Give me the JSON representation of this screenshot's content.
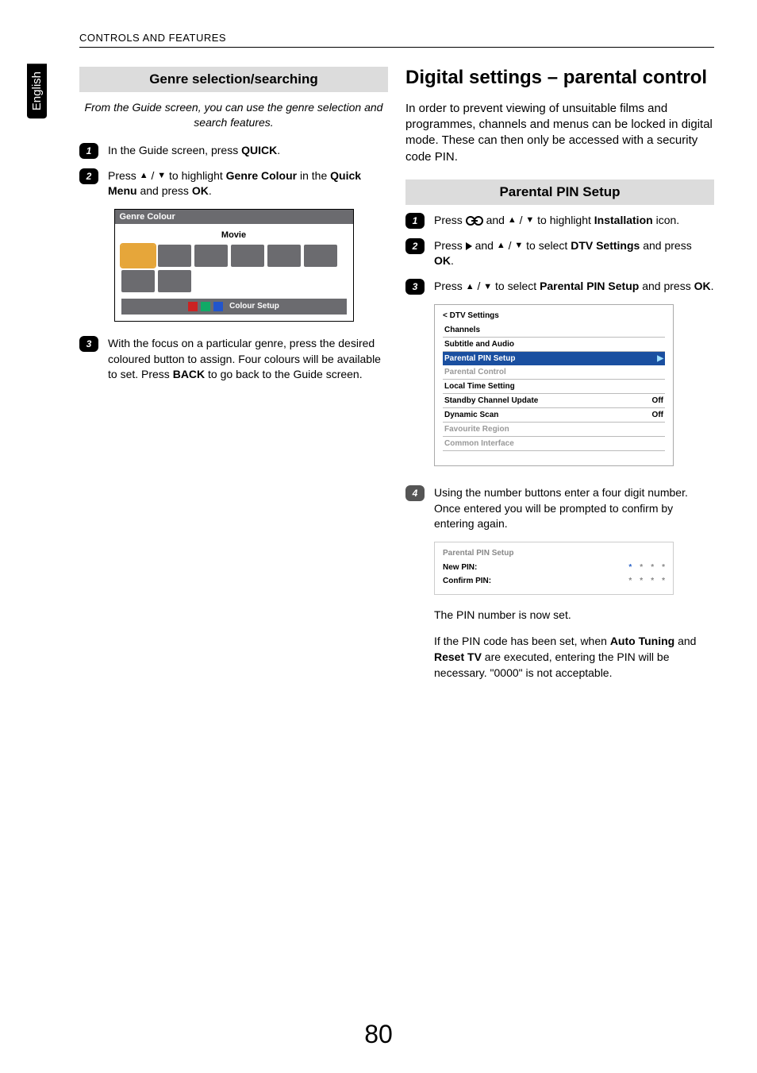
{
  "lang_tab": "English",
  "running_head": "CONTROLS AND FEATURES",
  "page_number": "80",
  "left": {
    "subhead": "Genre selection/searching",
    "intro": "From the Guide screen, you can use the genre selection and search features.",
    "steps": {
      "s1_a": "In the Guide screen, press ",
      "s1_b": "QUICK",
      "s1_c": ".",
      "s2_a": "Press ",
      "s2_b": " / ",
      "s2_c": " to highlight ",
      "s2_d": "Genre Colour",
      "s2_e": " in the ",
      "s2_f": "Quick Menu",
      "s2_g": " and press ",
      "s2_h": "OK",
      "s2_i": ".",
      "s3_a": "With the focus on a particular genre, press the desired coloured button to assign. Four colours will be available to set. Press ",
      "s3_b": "BACK",
      "s3_c": " to go back to the Guide screen."
    },
    "figure": {
      "title": "Genre Colour",
      "category": "Movie",
      "colour_setup": "Colour Setup"
    }
  },
  "right": {
    "h2": "Digital settings – parental control",
    "intro": "In order to prevent viewing of unsuitable films and programmes, channels and menus can be locked in digital mode. These can then only be accessed with a security code PIN.",
    "subhead": "Parental PIN Setup",
    "steps": {
      "s1_a": "Press ",
      "s1_b": " and ",
      "s1_c": " / ",
      "s1_d": " to highlight ",
      "s1_e": "Installation",
      "s1_f": " icon.",
      "s2_a": "Press ",
      "s2_b": " and ",
      "s2_c": " / ",
      "s2_d": " to select ",
      "s2_e": "DTV Settings",
      "s2_f": " and press ",
      "s2_g": "OK",
      "s2_h": ".",
      "s3_a": "Press ",
      "s3_b": " / ",
      "s3_c": " to select ",
      "s3_d": "Parental PIN Setup",
      "s3_e": " and press ",
      "s3_f": "OK",
      "s3_g": ".",
      "s4": "Using the number buttons enter a four digit number. Once entered you will be prompted to confirm by entering again."
    },
    "dtv": {
      "head": "< DTV Settings",
      "rows": [
        {
          "l": "Channels",
          "r": "",
          "cls": ""
        },
        {
          "l": "Subtitle and Audio",
          "r": "",
          "cls": ""
        },
        {
          "l": "Parental PIN Setup",
          "r": "▶",
          "cls": "hi"
        },
        {
          "l": "Parental Control",
          "r": "",
          "cls": "dim"
        },
        {
          "l": "Local Time Setting",
          "r": "",
          "cls": ""
        },
        {
          "l": "Standby Channel Update",
          "r": "Off",
          "cls": ""
        },
        {
          "l": "Dynamic Scan",
          "r": "Off",
          "cls": ""
        },
        {
          "l": "Favourite Region",
          "r": "",
          "cls": "dim"
        },
        {
          "l": "Common Interface",
          "r": "",
          "cls": "dim"
        }
      ]
    },
    "pin": {
      "title": "Parental PIN Setup",
      "new": "New PIN:",
      "confirm": "Confirm PIN:"
    },
    "after_pin": "The PIN number is now set.",
    "after_pin2_a": "If the PIN code has been set, when ",
    "after_pin2_b": "Auto Tuning",
    "after_pin2_c": " and ",
    "after_pin2_d": "Reset TV",
    "after_pin2_e": " are executed, entering the PIN will be necessary. \"0000\" is not acceptable."
  }
}
